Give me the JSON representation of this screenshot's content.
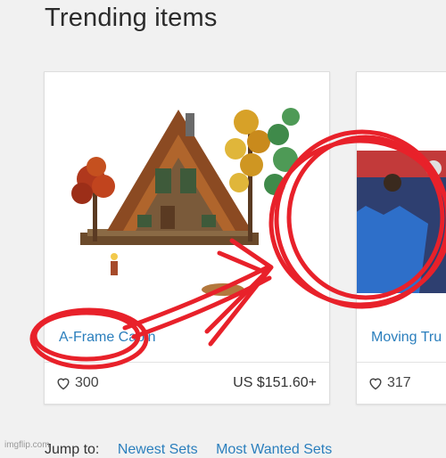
{
  "section_title": "Trending items",
  "cards": [
    {
      "title": "A-Frame Cabin",
      "likes": "300",
      "price": "US $151.60+"
    },
    {
      "title": "Moving Tru",
      "likes": "317",
      "price": ""
    }
  ],
  "footer": {
    "jump_label": "Jump to:",
    "links": [
      "Newest Sets",
      "Most Wanted Sets"
    ]
  },
  "watermark": "imgflip.com",
  "colors": {
    "link": "#2b7fbd",
    "annotation_red": "#e8212a"
  },
  "icons": [
    "heart-icon"
  ]
}
